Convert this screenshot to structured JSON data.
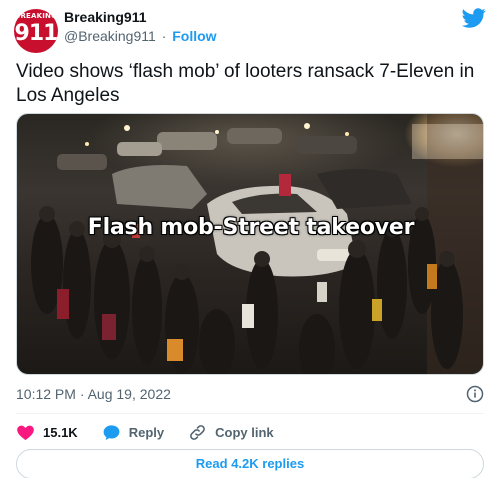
{
  "account": {
    "avatar_brand": "BREAKING",
    "avatar_number": "911",
    "display_name": "Breaking911",
    "handle": "@Breaking911",
    "separator": "·",
    "follow_label": "Follow"
  },
  "tweet": {
    "text": "Video shows ‘flash mob’ of looters ransack 7-Eleven in Los Angeles",
    "media_overlay_text": "Flash mob-Street takeover",
    "timestamp": "10:12 PM · Aug 19, 2022"
  },
  "actions": {
    "likes_count": "15.1K",
    "reply_label": "Reply",
    "copy_link_label": "Copy link"
  },
  "replies_button": "Read 4.2K replies",
  "icons": [
    "twitter-bird-icon",
    "info-icon",
    "heart-icon",
    "reply-bubble-icon",
    "link-icon"
  ],
  "colors": {
    "brand_blue": "#1d9bf0",
    "like_pink": "#f91880",
    "avatar_red": "#c8102e",
    "secondary_text": "#536471"
  }
}
